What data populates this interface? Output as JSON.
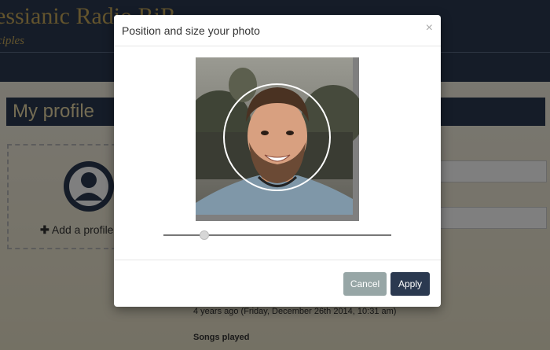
{
  "background": {
    "site_title": "essianic Radio RiR",
    "site_tagline": "ciples",
    "profile_heading": "My profile",
    "add_photo_label": "Add a profile p",
    "add_photo_icon": "plus-icon",
    "joined_text": "4 years ago (Friday, December 26th 2014, 10:31 am)",
    "songs_label": "Songs played"
  },
  "modal": {
    "title": "Position and size your photo",
    "close_label": "×",
    "zoom_level": 0.18,
    "cancel_label": "Cancel",
    "apply_label": "Apply"
  },
  "colors": {
    "header_navy": "#2b3950",
    "gold": "#c7a85a",
    "cancel_gray": "#97a6a6",
    "apply_navy": "#2b3950"
  }
}
